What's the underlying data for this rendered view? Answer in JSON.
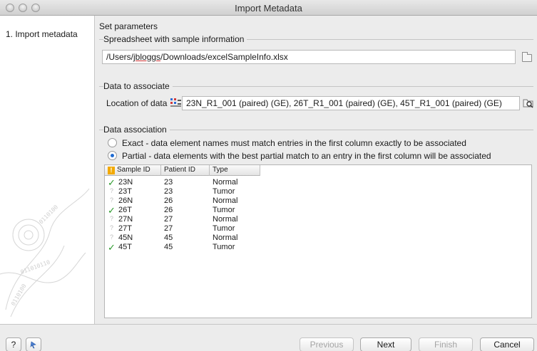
{
  "window": {
    "title": "Import Metadata"
  },
  "sidebar": {
    "steps": [
      {
        "label": "1.  Import metadata"
      }
    ]
  },
  "main": {
    "heading": "Set parameters",
    "spreadsheet": {
      "label": "Spreadsheet with sample information",
      "path_before": "/Users/",
      "path_user": "jbloggs",
      "path_after": "/Downloads/excelSampleInfo.xlsx"
    },
    "data_to_associate": {
      "label": "Data to associate",
      "location_label": "Location of data",
      "location_value": "23N_R1_001 (paired) (GE), 26T_R1_001 (paired) (GE), 45T_R1_001 (paired) (GE)"
    },
    "association": {
      "label": "Data association",
      "options": [
        {
          "label": "Exact - data element names must match entries in the first column exactly to be associated",
          "selected": false
        },
        {
          "label": "Partial - data elements with the best partial match to an entry in the first column will be associated",
          "selected": true
        }
      ]
    },
    "table": {
      "columns": [
        "Sample ID",
        "Patient ID",
        "Type"
      ],
      "rows": [
        {
          "status": "matched",
          "sample": "23N",
          "patient": "23",
          "type": "Normal"
        },
        {
          "status": "unmatched",
          "sample": "23T",
          "patient": "23",
          "type": "Tumor"
        },
        {
          "status": "unmatched",
          "sample": "26N",
          "patient": "26",
          "type": "Normal"
        },
        {
          "status": "matched",
          "sample": "26T",
          "patient": "26",
          "type": "Tumor"
        },
        {
          "status": "unmatched",
          "sample": "27N",
          "patient": "27",
          "type": "Normal"
        },
        {
          "status": "unmatched",
          "sample": "27T",
          "patient": "27",
          "type": "Tumor"
        },
        {
          "status": "unmatched",
          "sample": "45N",
          "patient": "45",
          "type": "Normal"
        },
        {
          "status": "matched",
          "sample": "45T",
          "patient": "45",
          "type": "Tumor"
        }
      ]
    }
  },
  "footer": {
    "help_label": "?",
    "previous_label": "Previous",
    "next_label": "Next",
    "finish_label": "Finish",
    "cancel_label": "Cancel"
  },
  "icons": {
    "help": "question-mark-icon",
    "reset": "reset-icon",
    "browse": "folder-icon",
    "dataset": "sequence-list-icon",
    "warning": "warning-icon",
    "match": "checkmark-icon",
    "nomatch": "question-icon"
  },
  "colors": {
    "radio_selected": "#1f6bd1",
    "check": "#2c9a2c",
    "warning": "#f2a900"
  }
}
